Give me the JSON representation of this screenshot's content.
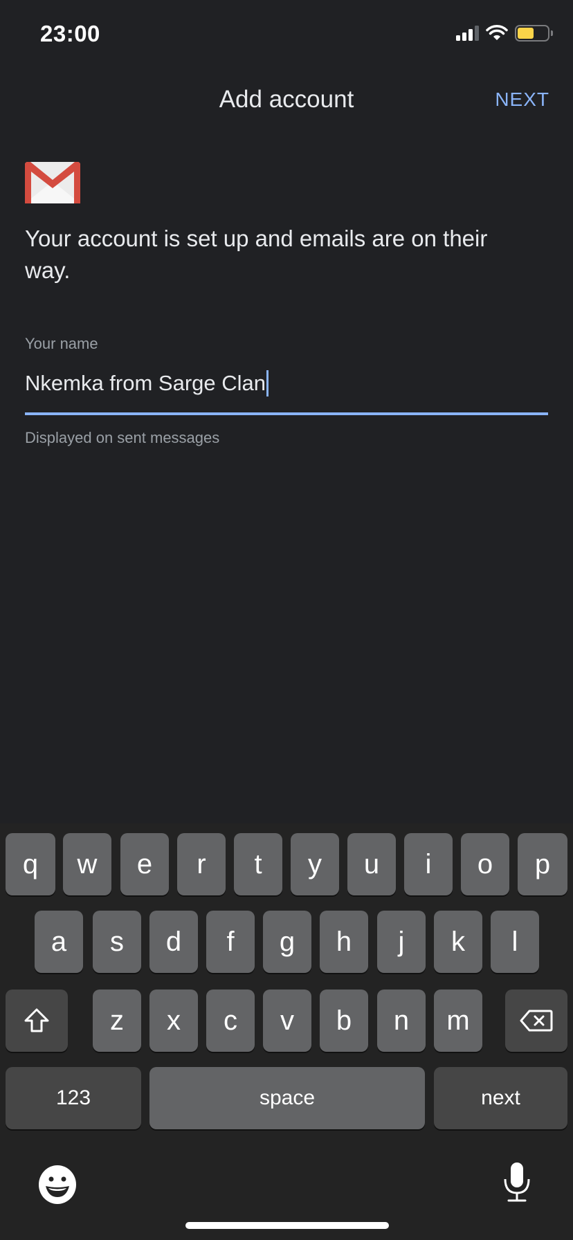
{
  "status_bar": {
    "time": "23:00",
    "icons": [
      "cellular-signal-icon",
      "wifi-icon",
      "battery-icon"
    ],
    "battery_level_fraction": 0.55,
    "battery_color": "#fbd449"
  },
  "app_bar": {
    "title": "Add account",
    "next_label": "NEXT",
    "accent_color": "#8ab4f8"
  },
  "content": {
    "logo": "gmail-icon",
    "message": "Your account is set up and emails are on their way.",
    "name_field": {
      "label": "Your name",
      "value": "Nkemka from Sarge Clan",
      "helper": "Displayed on sent messages"
    }
  },
  "keyboard": {
    "row1": [
      "q",
      "w",
      "e",
      "r",
      "t",
      "y",
      "u",
      "i",
      "o",
      "p"
    ],
    "row2": [
      "a",
      "s",
      "d",
      "f",
      "g",
      "h",
      "j",
      "k",
      "l"
    ],
    "row3": [
      "z",
      "x",
      "c",
      "v",
      "b",
      "n",
      "m"
    ],
    "shift_icon": "shift-icon",
    "backspace_icon": "backspace-icon",
    "numbers_label": "123",
    "space_label": "space",
    "return_label": "next",
    "emoji_icon": "emoji-icon",
    "mic_icon": "microphone-icon"
  }
}
